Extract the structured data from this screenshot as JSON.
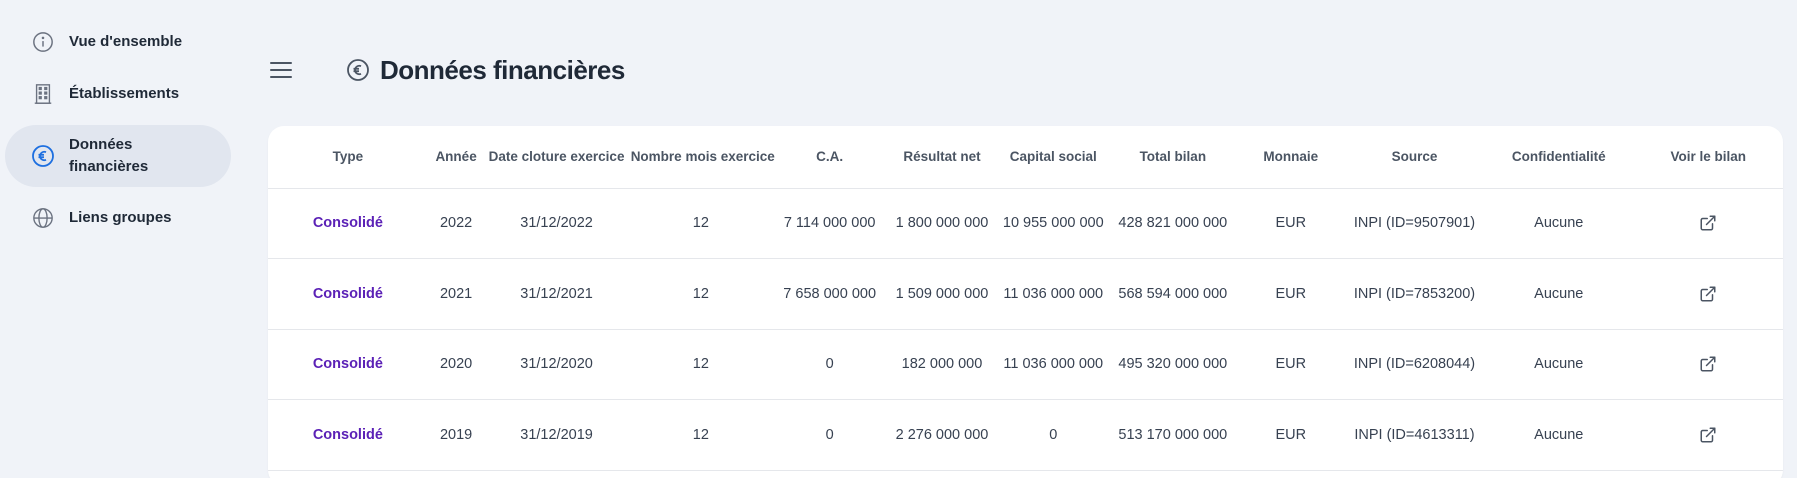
{
  "sidebar": {
    "items": [
      {
        "label": "Vue d'ensemble",
        "icon": "info-circle-icon"
      },
      {
        "label": "Établissements",
        "icon": "building-icon"
      },
      {
        "label": "Données financières",
        "icon": "euro-circle-icon",
        "active": true
      },
      {
        "label": "Liens groupes",
        "icon": "globe-icon"
      }
    ]
  },
  "header": {
    "title": "Données financières"
  },
  "colors": {
    "accent": "#1d6fe0",
    "type_text": "#5b21b6",
    "background": "#f0f3f8"
  },
  "table": {
    "columns": [
      "Type",
      "Année",
      "Date cloture exercice",
      "Nombre mois exercice",
      "C.A.",
      "Résultat net",
      "Capital social",
      "Total bilan",
      "Monnaie",
      "Source",
      "Confidentialité",
      "Voir le bilan"
    ],
    "rows": [
      {
        "type": "Consolidé",
        "annee": "2022",
        "date": "31/12/2022",
        "mois": "12",
        "ca": "7 114 000 000",
        "resultat": "1 800 000 000",
        "capital": "10 955 000 000",
        "bilan": "428 821 000 000",
        "monnaie": "EUR",
        "source": "INPI (ID=9507901)",
        "confidentialite": "Aucune"
      },
      {
        "type": "Consolidé",
        "annee": "2021",
        "date": "31/12/2021",
        "mois": "12",
        "ca": "7 658 000 000",
        "resultat": "1 509 000 000",
        "capital": "11 036 000 000",
        "bilan": "568 594 000 000",
        "monnaie": "EUR",
        "source": "INPI (ID=7853200)",
        "confidentialite": "Aucune"
      },
      {
        "type": "Consolidé",
        "annee": "2020",
        "date": "31/12/2020",
        "mois": "12",
        "ca": "0",
        "resultat": "182 000 000",
        "capital": "11 036 000 000",
        "bilan": "495 320 000 000",
        "monnaie": "EUR",
        "source": "INPI (ID=6208044)",
        "confidentialite": "Aucune"
      },
      {
        "type": "Consolidé",
        "annee": "2019",
        "date": "31/12/2019",
        "mois": "12",
        "ca": "0",
        "resultat": "2 276 000 000",
        "capital": "0",
        "bilan": "513 170 000 000",
        "monnaie": "EUR",
        "source": "INPI (ID=4613311)",
        "confidentialite": "Aucune"
      }
    ]
  }
}
